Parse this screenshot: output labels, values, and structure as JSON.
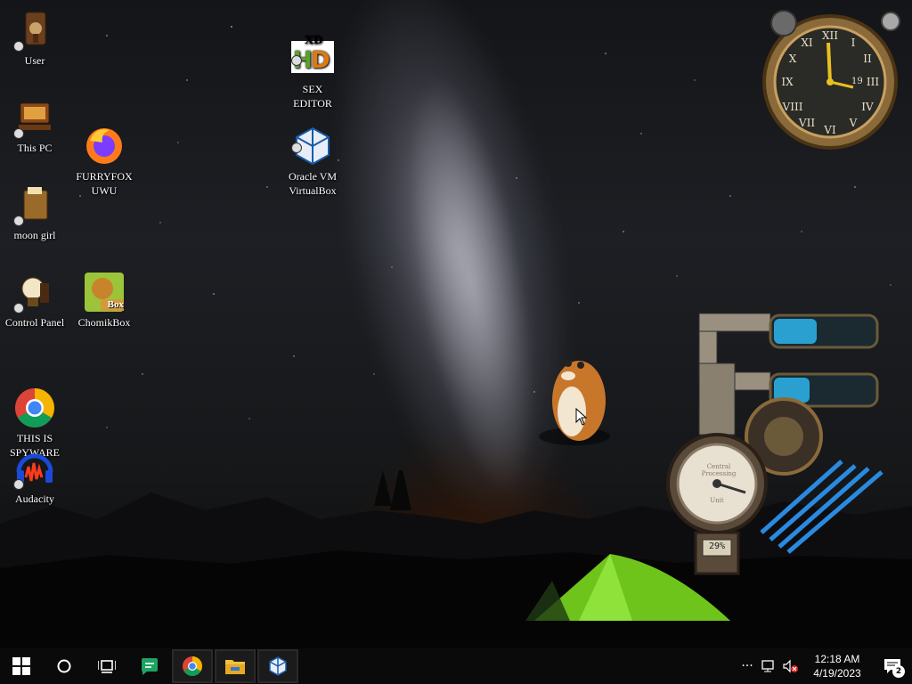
{
  "desktop": {
    "icons": [
      {
        "label": "User",
        "glyph": "user-folder-icon"
      },
      {
        "label": "This PC",
        "glyph": "this-pc-icon"
      },
      {
        "label": "FURRYFOX\nUWU",
        "glyph": "firefox-icon"
      },
      {
        "label": "moon girl",
        "glyph": "folder-icon"
      },
      {
        "label": "Control Panel",
        "glyph": "control-panel-icon"
      },
      {
        "label": "ChomikBox",
        "glyph": "chomikbox-icon"
      },
      {
        "label": "THIS IS\nSPYWARE",
        "glyph": "chrome-icon"
      },
      {
        "label": "Audacity",
        "glyph": "audacity-icon"
      },
      {
        "label": "SEX\nEDITOR",
        "glyph": "hxd-icon"
      },
      {
        "label": "Oracle VM\nVirtualBox",
        "glyph": "virtualbox-icon"
      }
    ],
    "chomikbox_badge": "Box",
    "hxd_badge": "XD"
  },
  "widgets": {
    "clock_date": "19",
    "gauge_percent": "29%",
    "gauge_top_label": "Central Processing",
    "gauge_bottom_label": "Unit"
  },
  "taskbar": {
    "start": "windows-start-icon",
    "search": "search-circle-icon",
    "task_view": "task-view-icon",
    "apps": [
      "google-chat-icon",
      "chrome-icon",
      "file-explorer-icon",
      "virtualbox-icon"
    ],
    "overflow": "···",
    "time": "12:18 AM",
    "date": "4/19/2023",
    "notification_count": "2"
  },
  "colors": {
    "taskbar": "#0a0a0a",
    "tent": "#7ed321",
    "brass": "#b08a4a"
  }
}
